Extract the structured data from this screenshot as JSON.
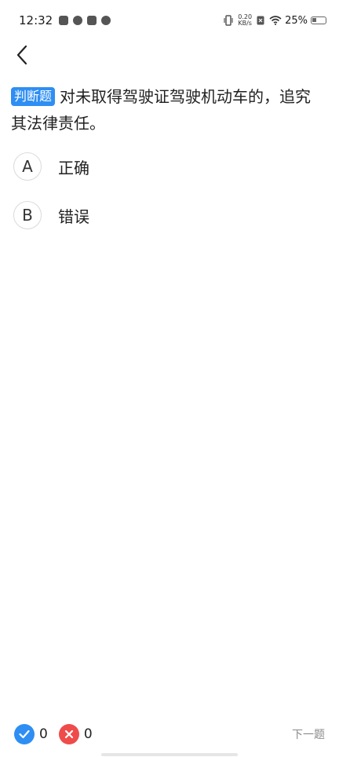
{
  "status_bar": {
    "time": "12:32",
    "net_speed_value": "0.20",
    "net_speed_unit": "KB/s",
    "battery_text": "25%"
  },
  "question": {
    "type_label": "判断题",
    "text": "对未取得驾驶证驾驶机动车的，追究其法律责任。"
  },
  "options": [
    {
      "letter": "A",
      "text": "正确"
    },
    {
      "letter": "B",
      "text": "错误"
    }
  ],
  "footer": {
    "correct_count": "0",
    "wrong_count": "0",
    "next_label": "下一题"
  },
  "colors": {
    "accent": "#2e8ef3",
    "wrong": "#f04b4b",
    "correct": "#2e8ef3"
  }
}
